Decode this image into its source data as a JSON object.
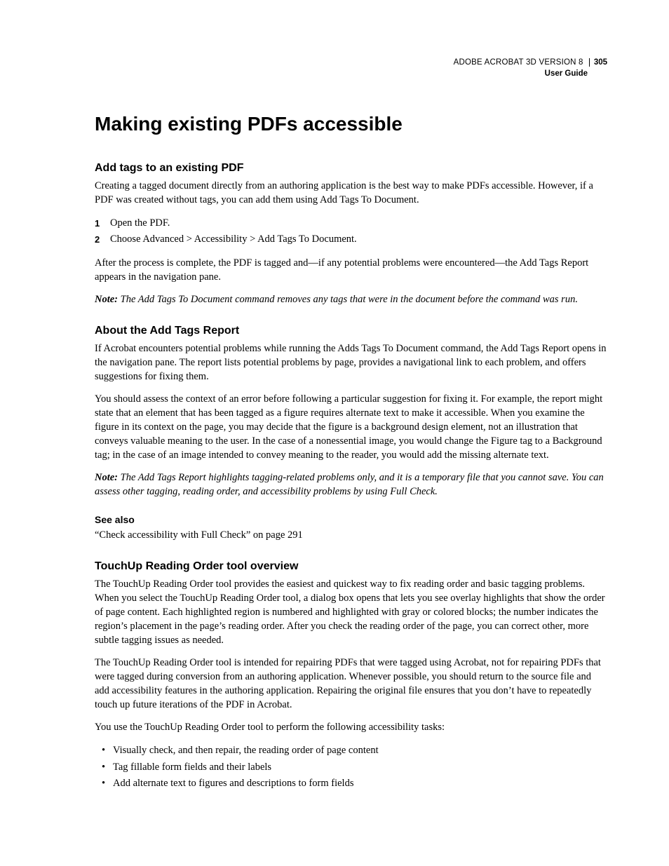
{
  "header": {
    "product": "ADOBE ACROBAT 3D VERSION 8",
    "page_number": "305",
    "subtitle": "User Guide"
  },
  "title": "Making existing PDFs accessible",
  "sections": [
    {
      "heading": "Add tags to an existing PDF",
      "intro": "Creating a tagged document directly from an authoring application is the best way to make PDFs accessible. However, if a PDF was created without tags, you can add them using Add Tags To Document.",
      "steps": [
        "Open the PDF.",
        "Choose Advanced > Accessibility > Add Tags To Document."
      ],
      "after_steps": "After the process is complete, the PDF is tagged and—if any potential problems were encountered—the Add Tags Report appears in the navigation pane.",
      "note_label": "Note:",
      "note": "The Add Tags To Document command removes any tags that were in the document before the command was run."
    },
    {
      "heading": "About the Add Tags Report",
      "p1": "If Acrobat encounters potential problems while running the Adds Tags To Document command, the Add Tags Report opens in the navigation pane. The report lists potential problems by page, provides a navigational link to each problem, and offers suggestions for fixing them.",
      "p2": "You should assess the context of an error before following a particular suggestion for fixing it. For example, the report might state that an element that has been tagged as a figure requires alternate text to make it accessible. When you examine the figure in its context on the page, you may decide that the figure is a background design element, not an illustration that conveys valuable meaning to the user. In the case of a nonessential image, you would change the Figure tag to a Background tag; in the case of an image intended to convey meaning to the reader, you would add the missing alternate text.",
      "note_label": "Note:",
      "note": "The Add Tags Report highlights tagging-related problems only, and it is a temporary file that you cannot save. You can assess other tagging, reading order, and accessibility problems by using Full Check."
    }
  ],
  "see_also": {
    "heading": "See also",
    "link": "“Check accessibility with Full Check” on page 291"
  },
  "touchup": {
    "heading": "TouchUp Reading Order tool overview",
    "p1": "The TouchUp Reading Order tool provides the easiest and quickest way to fix reading order and basic tagging problems. When you select the TouchUp Reading Order tool, a dialog box opens that lets you see overlay highlights that show the order of page content. Each highlighted region is numbered and highlighted with gray or colored blocks; the number indicates the region’s placement in the page’s reading order. After you check the reading order of the page, you can correct other, more subtle tagging issues as needed.",
    "p2": "The TouchUp Reading Order tool is intended for repairing PDFs that were tagged using Acrobat, not for repairing PDFs that were tagged during conversion from an authoring application. Whenever possible, you should return to the source file and add accessibility features in the authoring application. Repairing the original file ensures that you don’t have to repeatedly touch up future iterations of the PDF in Acrobat.",
    "p3": "You use the TouchUp Reading Order tool to perform the following accessibility tasks:",
    "bullets": [
      "Visually check, and then repair, the reading order of page content",
      "Tag fillable form fields and their labels",
      "Add alternate text to figures and descriptions to form fields"
    ]
  }
}
